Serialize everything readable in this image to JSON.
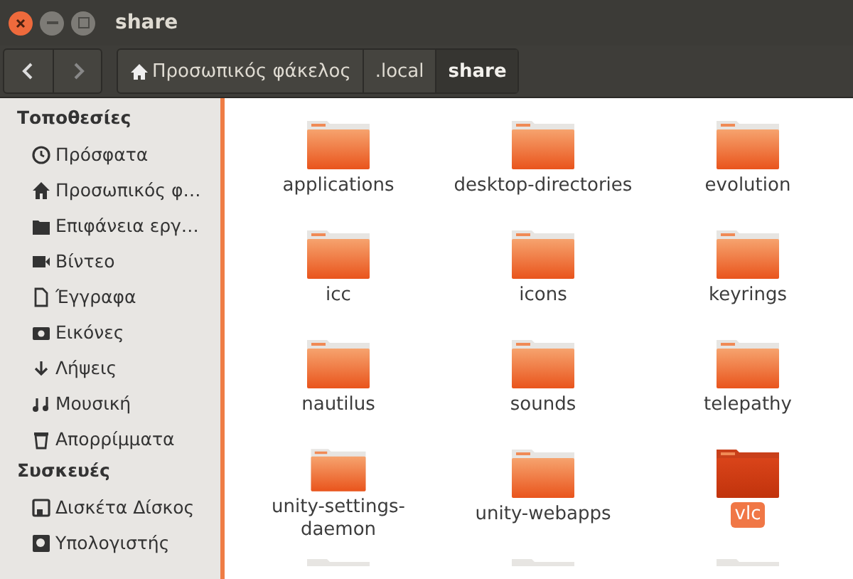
{
  "window": {
    "title": "share"
  },
  "breadcrumbs": [
    {
      "label": "Προσωπικός φάκελος",
      "selected": false
    },
    {
      "label": ".local",
      "selected": false
    },
    {
      "label": "share",
      "selected": true
    }
  ],
  "sidebar": {
    "sections": [
      {
        "title": "Τοποθεσίες",
        "items": [
          {
            "label": "Πρόσφατα"
          },
          {
            "label": "Προσωπικός φ…"
          },
          {
            "label": "Επιφάνεια εργ…"
          },
          {
            "label": "Βίντεο"
          },
          {
            "label": "Έγγραφα"
          },
          {
            "label": "Εικόνες"
          },
          {
            "label": "Λήψεις"
          },
          {
            "label": "Μουσική"
          },
          {
            "label": "Απορρίμματα"
          }
        ]
      },
      {
        "title": "Συσκευές",
        "items": [
          {
            "label": "Δισκέτα Δίσκος"
          },
          {
            "label": "Υπολογιστής"
          }
        ]
      }
    ]
  },
  "folders": [
    {
      "name": "applications",
      "selected": false
    },
    {
      "name": "desktop-directories",
      "selected": false
    },
    {
      "name": "evolution",
      "selected": false
    },
    {
      "name": "icc",
      "selected": false
    },
    {
      "name": "icons",
      "selected": false
    },
    {
      "name": "keyrings",
      "selected": false
    },
    {
      "name": "nautilus",
      "selected": false
    },
    {
      "name": "sounds",
      "selected": false
    },
    {
      "name": "telepathy",
      "selected": false
    },
    {
      "name": "unity-settings-daemon",
      "selected": false
    },
    {
      "name": "unity-webapps",
      "selected": false
    },
    {
      "name": "vlc",
      "selected": true
    }
  ]
}
